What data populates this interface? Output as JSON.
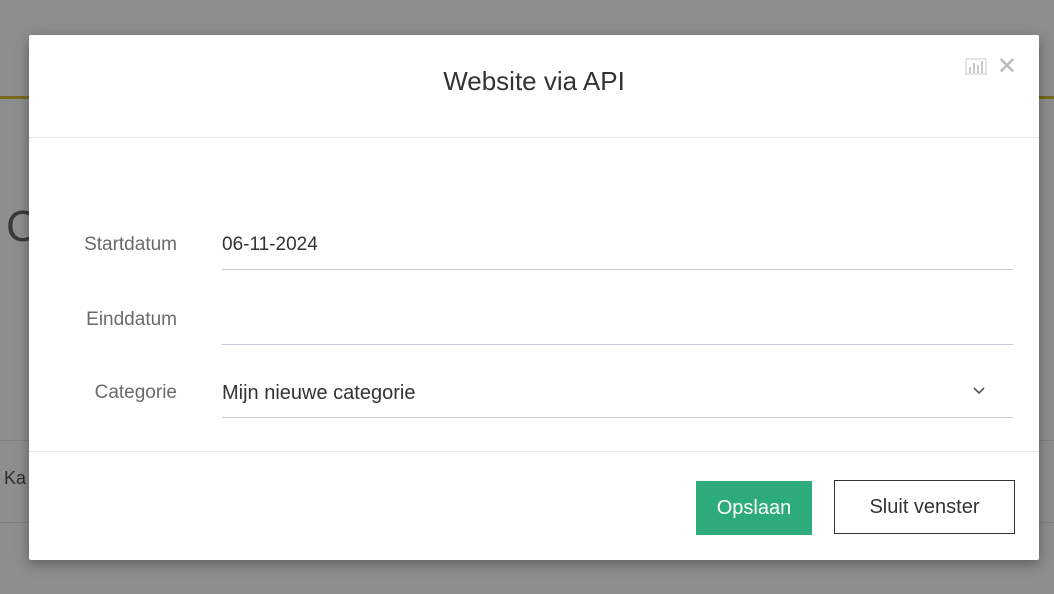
{
  "background": {
    "heading_fragment": "C",
    "cell_fragment": "Ka"
  },
  "modal": {
    "title": "Website via API",
    "header_icons": [
      "chart-icon",
      "close-icon"
    ],
    "close_glyph": "✕",
    "fields": {
      "startdatum": {
        "label": "Startdatum",
        "value": "06-11-2024"
      },
      "einddatum": {
        "label": "Einddatum",
        "value": ""
      },
      "categorie": {
        "label": "Categorie",
        "value": "Mijn nieuwe categorie"
      }
    },
    "buttons": {
      "save": "Opslaan",
      "close": "Sluit venster"
    }
  },
  "colors": {
    "save_button": "#2dab7b",
    "overlay": "#8e8e8e",
    "header_accent": "#7a6a1e"
  }
}
